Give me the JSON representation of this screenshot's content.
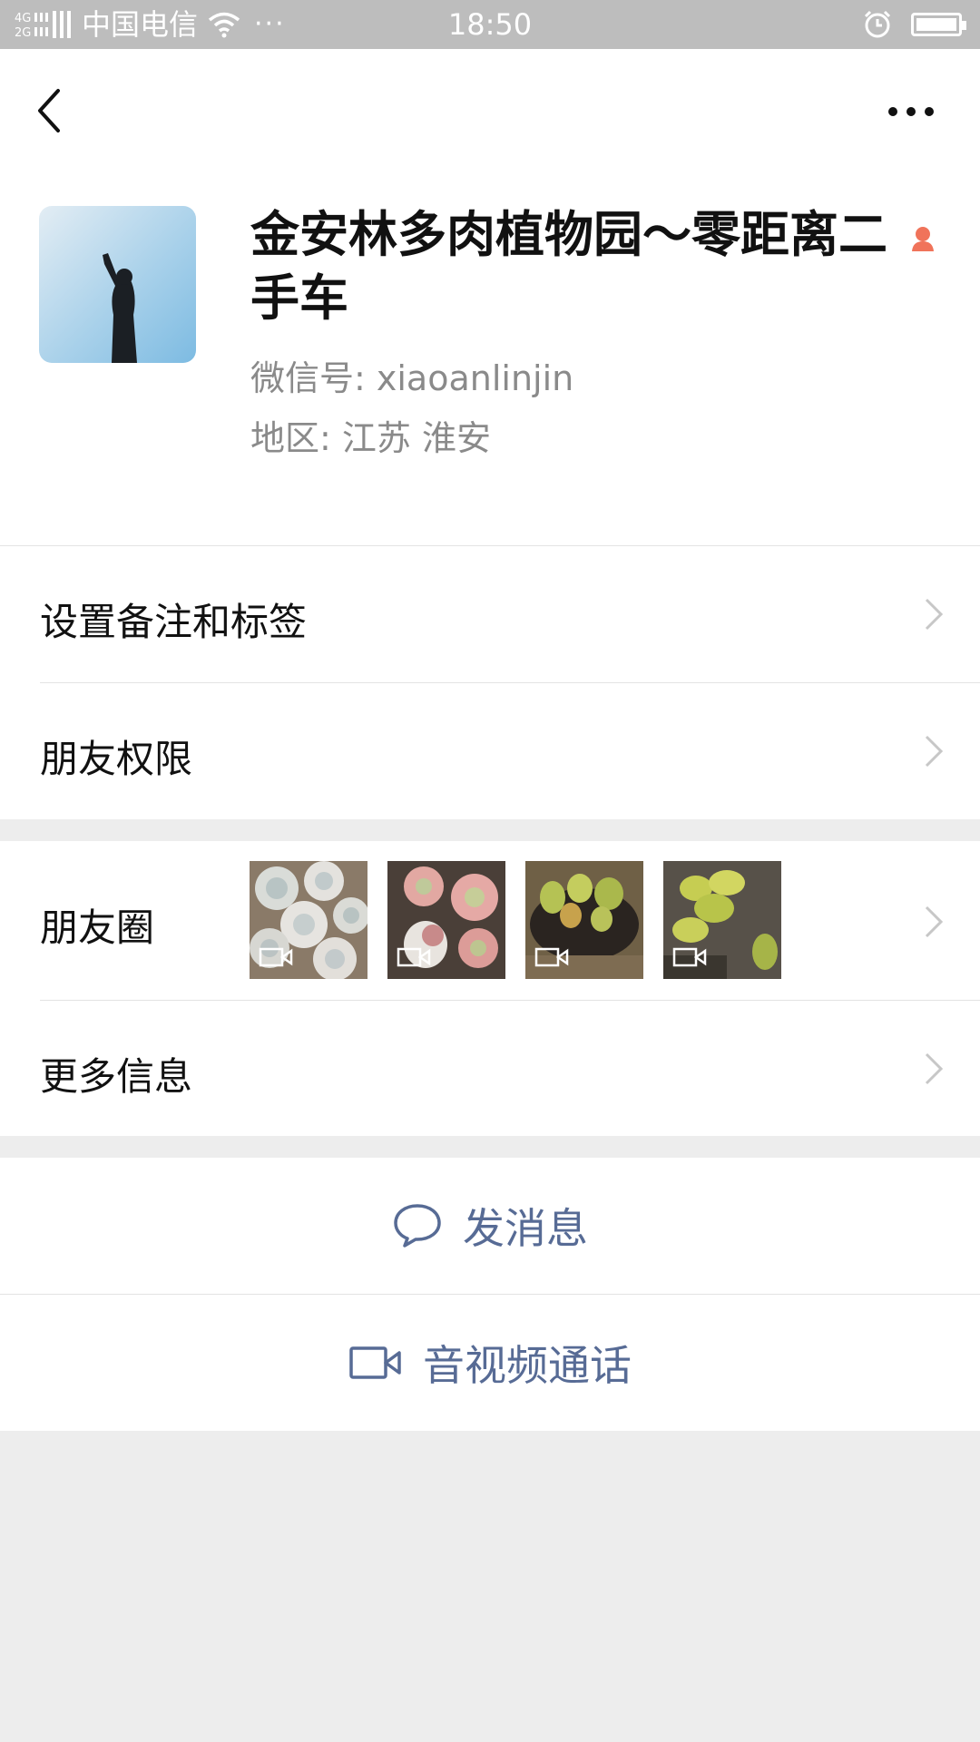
{
  "status_bar": {
    "network": "4G 2G",
    "carrier": "中国电信",
    "overflow": "···",
    "time": "18:50",
    "icons": [
      "signal-icon",
      "wifi-icon",
      "alarm-icon",
      "battery-icon"
    ]
  },
  "nav": {
    "back_icon": "back-chevron-icon",
    "more_icon": "more-dots-icon"
  },
  "profile": {
    "name": "金安林多肉植物园～零距离二手车",
    "gender_icon": "female-icon",
    "wxid_label": "微信号: xiaoanlinjin",
    "region_label": "地区: 江苏  淮安"
  },
  "settings": {
    "remark_label": "设置备注和标签",
    "permission_label": "朋友权限"
  },
  "moments": {
    "label": "朋友圈",
    "thumbnails": [
      "succulent-rosettes-photo",
      "pink-succulent-photo",
      "green-succulent-pot-photo",
      "yellow-succulent-photo"
    ]
  },
  "more_info": {
    "label": "更多信息"
  },
  "actions": {
    "message_label": "发消息",
    "call_label": "音视频通话"
  },
  "colors": {
    "link_blue": "#576b95",
    "background": "#ededed",
    "status_bar": "#bdbdbd"
  }
}
